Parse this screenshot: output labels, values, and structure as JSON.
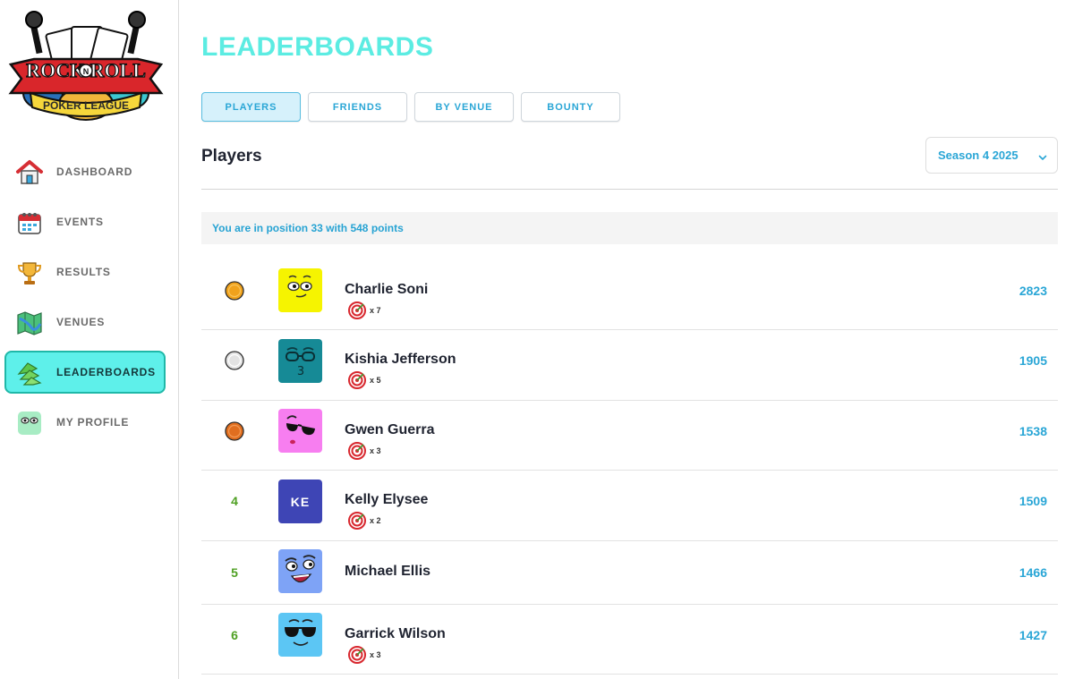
{
  "sidebar": {
    "logo": {
      "line1": "ROCK",
      "line2": "N",
      "line3": "ROLL",
      "line4": "POKER LEAGUE"
    },
    "items": [
      {
        "label": "DASHBOARD",
        "icon": "house-icon"
      },
      {
        "label": "EVENTS",
        "icon": "calendar-icon"
      },
      {
        "label": "RESULTS",
        "icon": "trophy-icon"
      },
      {
        "label": "VENUES",
        "icon": "map-icon"
      },
      {
        "label": "LEADERBOARDS",
        "icon": "leaderboard-icon",
        "active": true
      },
      {
        "label": "MY PROFILE",
        "icon": "face-icon"
      }
    ]
  },
  "main": {
    "title": "LEADERBOARDS",
    "tabs": [
      {
        "label": "PLAYERS",
        "active": true
      },
      {
        "label": "FRIENDS"
      },
      {
        "label": "BY VENUE"
      },
      {
        "label": "BOUNTY"
      }
    ],
    "section_title": "Players",
    "season_select": {
      "value": "Season 4 2025"
    },
    "position_banner": "You are in position 33 with 548 points",
    "players": [
      {
        "rank": "1",
        "medal": "gold",
        "name": "Charlie Soni",
        "badge_count": "x 7",
        "points": "2823",
        "avatar_color": "#f6f400"
      },
      {
        "rank": "2",
        "medal": "silver",
        "name": "Kishia Jefferson",
        "badge_count": "x 5",
        "points": "1905",
        "avatar_color": "#168a96"
      },
      {
        "rank": "3",
        "medal": "bronze",
        "name": "Gwen Guerra",
        "badge_count": "x 3",
        "points": "1538",
        "avatar_color": "#f77ef0"
      },
      {
        "rank": "4",
        "medal": "",
        "name": "Kelly Elysee",
        "badge_count": "x 2",
        "points": "1509",
        "avatar_color": "#3e45b5",
        "initials": "KE"
      },
      {
        "rank": "5",
        "medal": "",
        "name": "Michael Ellis",
        "badge_count": "",
        "points": "1466",
        "avatar_color": "#7ea3f6"
      },
      {
        "rank": "6",
        "medal": "",
        "name": "Garrick Wilson",
        "badge_count": "x 3",
        "points": "1427",
        "avatar_color": "#5cc6f4"
      }
    ]
  },
  "colors": {
    "accent": "#5cece2",
    "link": "#2aa6d6",
    "rank_green": "#4fa023",
    "active_nav": "#5ef0ea"
  }
}
